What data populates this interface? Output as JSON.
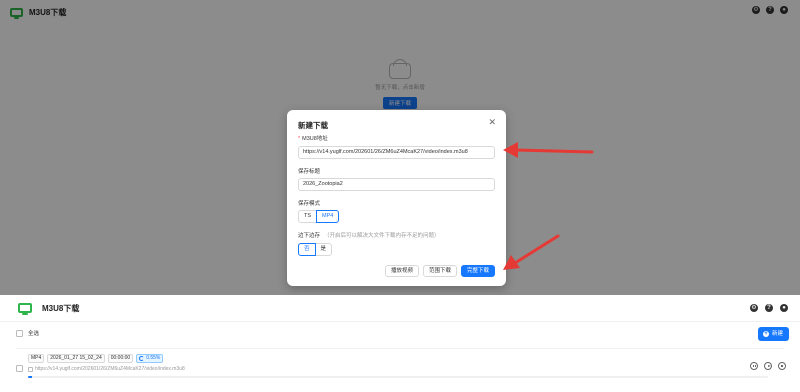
{
  "top": {
    "app_title": "M3U8下载",
    "empty_text": "暂无下载，点击新增",
    "empty_button": "新建下载"
  },
  "modal": {
    "title": "新建下载",
    "url_label": "M3U8地址",
    "url_value": "https://v14.yuglf.com/202601/26/ZM6uZ4McaK27/video/index.m3u8",
    "title_label": "保存标题",
    "title_value": "2026_Zootopia2",
    "mode_label": "保存模式",
    "mode_options": [
      "TS",
      "MP4"
    ],
    "mode_selected": "MP4",
    "stream_label": "边下边存",
    "stream_hint": "（开启后可以解决大文件下载内存不足的问题）",
    "stream_options": [
      "否",
      "是"
    ],
    "stream_selected": "否",
    "buttons": {
      "play": "播放视频",
      "range": "范围下载",
      "full": "完整下载"
    }
  },
  "bottom": {
    "app_title": "M3U8下载",
    "select_all": "全选",
    "new_button": "新建",
    "items": [
      {
        "format": "MP4",
        "name": "2026_01_27 15_02_24",
        "duration": "00:00:00",
        "progress_text": "0.55%",
        "progress": 0.0055,
        "url": "https://v14.yuglf.com/202601/26/ZM6uZ4McaK27/video/index.m3u8"
      }
    ]
  },
  "colors": {
    "accent": "#1677ff",
    "brand": "#2fb54b",
    "annotation": "#e53935"
  },
  "icons": {
    "settings": "gear-icon",
    "help": "question-icon",
    "github": "github-icon"
  }
}
